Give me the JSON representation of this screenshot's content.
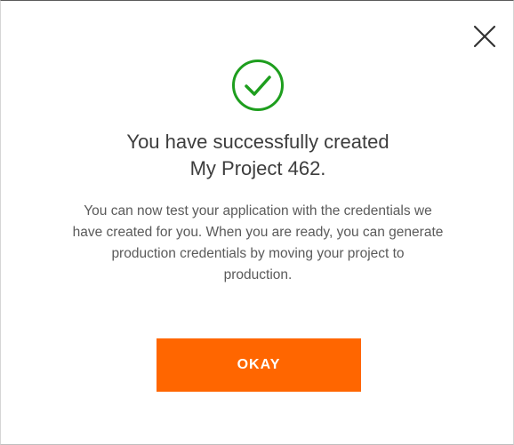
{
  "dialog": {
    "title_line1": "You have successfully created",
    "title_line2": "My Project 462.",
    "message_lines": [
      "You can now test your application with the credentials we",
      "have created for you. When you are ready, you can generate",
      "production credentials by moving your project to",
      "production."
    ],
    "okay_label": "OKAY",
    "close_icon": "close-icon",
    "success_icon": "checkmark-circle-icon"
  },
  "colors": {
    "accent": "#ff6600",
    "success": "#1e9e1e",
    "title_text": "#3d3d3d",
    "body_text": "#5a5a5a"
  }
}
